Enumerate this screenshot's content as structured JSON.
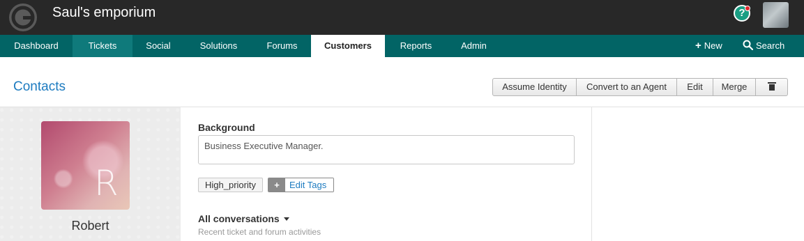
{
  "header": {
    "brand": "Saul's emporium",
    "help_icon_glyph": "?",
    "icons": [
      "logo-icon",
      "help-icon",
      "notification-dot",
      "user-avatar"
    ]
  },
  "nav": {
    "tabs": [
      "Dashboard",
      "Tickets",
      "Social",
      "Solutions",
      "Forums",
      "Customers",
      "Reports",
      "Admin"
    ],
    "active_tab": "Customers",
    "new_label": "New",
    "new_icon": "+",
    "search_label": "Search"
  },
  "page": {
    "title": "Contacts",
    "actions": {
      "assume_identity": "Assume Identity",
      "convert_agent": "Convert to an Agent",
      "edit": "Edit",
      "merge": "Merge"
    }
  },
  "profile": {
    "initial": "R",
    "name": "Robert"
  },
  "details": {
    "background_label": "Background",
    "background_value": "Business Executive Manager.",
    "tags": [
      "High_priority"
    ],
    "edit_tags_plus": "+",
    "edit_tags_label": "Edit Tags",
    "conversations_title": "All conversations",
    "conversations_subtitle": "Recent ticket and forum activities"
  },
  "colors": {
    "topbar": "#282828",
    "navbar": "#026465",
    "link": "#1d7bc0",
    "help_green": "#1a9e83",
    "notif_red": "#e0262c"
  }
}
